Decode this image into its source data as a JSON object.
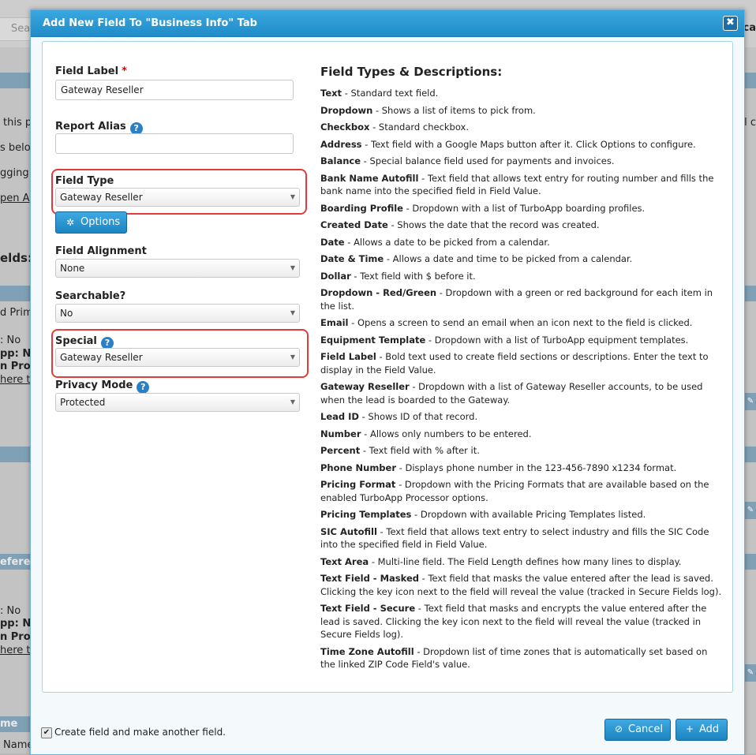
{
  "background": {
    "search_placeholder": "Sea",
    "right_top_text": "ca",
    "text_this": "this p",
    "text_below": "s belo",
    "text_logging": "gging",
    "text_open": "pen A",
    "text_fields": "elds:",
    "text_prim": "d Prim",
    "text_no": ": No",
    "text_app": "pp: N",
    "text_prop": "n Prop",
    "text_where": "here t",
    "text_referen": "eferen",
    "text_no2": ": No",
    "text_app2": "pp: N",
    "text_prop2": "n Prop",
    "text_where2": "here t",
    "text_name_hdr": "me",
    "text_name": "Name",
    "right_c": "l c"
  },
  "modal": {
    "title": "Add New Field To \"Business Info\" Tab",
    "close_label": "✖"
  },
  "form": {
    "field_label": {
      "label": "Field Label",
      "required_mark": "*",
      "value": "Gateway Reseller"
    },
    "report_alias": {
      "label": "Report Alias",
      "value": "",
      "help": "?"
    },
    "field_type": {
      "label": "Field Type",
      "value": "Gateway Reseller"
    },
    "options_button": "Options",
    "field_alignment": {
      "label": "Field Alignment",
      "value": "None"
    },
    "searchable": {
      "label": "Searchable?",
      "value": "No"
    },
    "special": {
      "label": "Special",
      "value": "Gateway Reseller",
      "help": "?"
    },
    "privacy_mode": {
      "label": "Privacy Mode",
      "value": "Protected",
      "help": "?"
    }
  },
  "descriptions": {
    "title": "Field Types & Descriptions:",
    "items": [
      {
        "name": "Text",
        "desc": " - Standard text field."
      },
      {
        "name": "Dropdown",
        "desc": " - Shows a list of items to pick from."
      },
      {
        "name": "Checkbox",
        "desc": " - Standard checkbox."
      },
      {
        "name": "Address",
        "desc": " - Text field with a Google Maps button after it. Click Options to configure."
      },
      {
        "name": "Balance",
        "desc": " - Special balance field used for payments and invoices."
      },
      {
        "name": "Bank Name Autofill",
        "desc": " - Text field that allows text entry for routing number and fills the bank name into the specified field in Field Value."
      },
      {
        "name": "Boarding Profile",
        "desc": " - Dropdown with a list of TurboApp boarding profiles."
      },
      {
        "name": "Created Date",
        "desc": " - Shows the date that the record was created."
      },
      {
        "name": "Date",
        "desc": " - Allows a date to be picked from a calendar."
      },
      {
        "name": "Date & Time",
        "desc": " - Allows a date and time to be picked from a calendar."
      },
      {
        "name": "Dollar",
        "desc": " - Text field with $ before it."
      },
      {
        "name": "Dropdown - Red/Green",
        "desc": " - Dropdown with a green or red background for each item in the list."
      },
      {
        "name": "Email",
        "desc": " - Opens a screen to send an email when an icon next to the field is clicked."
      },
      {
        "name": "Equipment Template",
        "desc": " - Dropdown with a list of TurboApp equipment templates."
      },
      {
        "name": "Field Label",
        "desc": " - Bold text used to create field sections or descriptions. Enter the text to display in the Field Value."
      },
      {
        "name": "Gateway Reseller",
        "desc": " - Dropdown with a list of Gateway Reseller accounts, to be used when the lead is boarded to the Gateway."
      },
      {
        "name": "Lead ID",
        "desc": " - Shows ID of that record."
      },
      {
        "name": "Number",
        "desc": " - Allows only numbers to be entered."
      },
      {
        "name": "Percent",
        "desc": " - Text field with % after it."
      },
      {
        "name": "Phone Number",
        "desc": " - Displays phone number in the 123-456-7890 x1234 format."
      },
      {
        "name": "Pricing Format",
        "desc": " - Dropdown with the Pricing Formats that are available based on the enabled TurboApp Processor options."
      },
      {
        "name": "Pricing Templates",
        "desc": " - Dropdown with available Pricing Templates listed."
      },
      {
        "name": "SIC Autofill",
        "desc": " - Text field that allows text entry to select industry and fills the SIC Code into the specified field in Field Value."
      },
      {
        "name": "Text Area",
        "desc": " - Multi-line field. The Field Length defines how many lines to display."
      },
      {
        "name": "Text Field - Masked",
        "desc": " - Text field that masks the value entered after the lead is saved. Clicking the key icon next to the field will reveal the value (tracked in Secure Fields log)."
      },
      {
        "name": "Text Field - Secure",
        "desc": " - Text field that masks and encrypts the value entered after the lead is saved. Clicking the key icon next to the field will reveal the value (tracked in Secure Fields log)."
      },
      {
        "name": "Time Zone Autofill",
        "desc": " - Dropdown list of time zones that is automatically set based on the linked ZIP Code Field's value."
      }
    ]
  },
  "footer": {
    "checkbox_checked": true,
    "checkbox_label": "Create field and make another field.",
    "cancel_label": "Cancel",
    "add_label": "Add"
  },
  "colors": {
    "header_blue": "#2a9ad6",
    "button_blue": "#1c84c0",
    "highlight_red": "#e23b3b",
    "required_red": "#dd0000"
  }
}
